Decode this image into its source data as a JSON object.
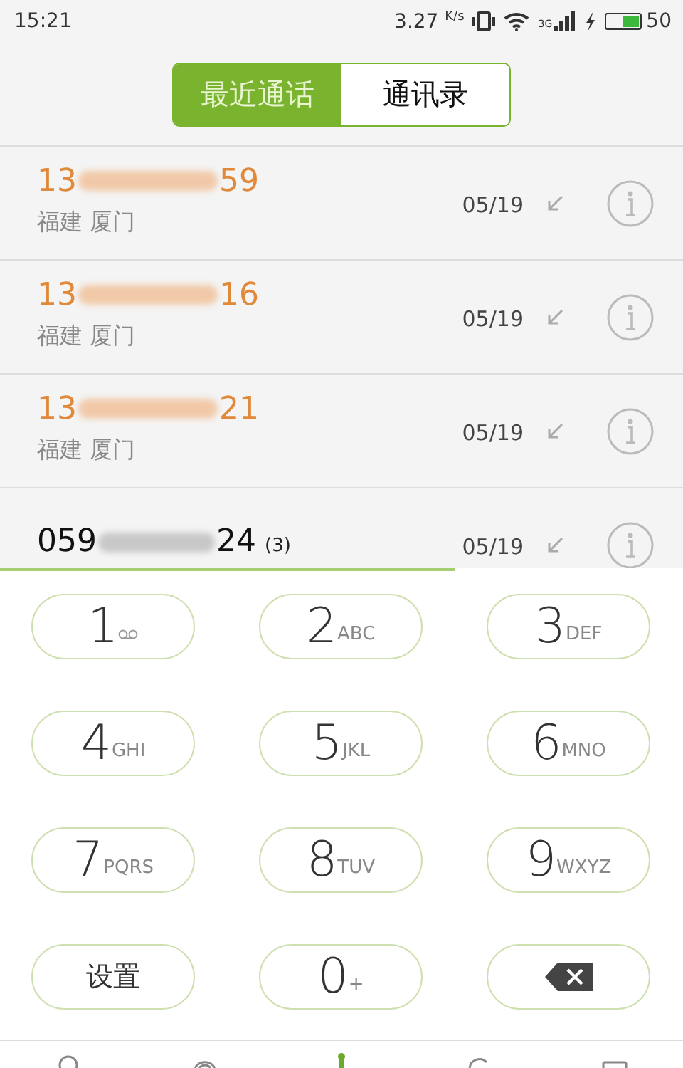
{
  "status_bar": {
    "time": "15:21",
    "speed": "3.27",
    "speed_unit": "K/s",
    "network": "3G",
    "battery": "50"
  },
  "tabs": [
    {
      "label": "最近通话",
      "selected": true
    },
    {
      "label": "通讯录",
      "selected": false
    }
  ],
  "calls": [
    {
      "number_start": "13",
      "number_end": "59",
      "location": "福建 厦门",
      "date": "05/19",
      "missed": true
    },
    {
      "number_start": "13",
      "number_end": "16",
      "location": "福建 厦门",
      "date": "05/19",
      "missed": true
    },
    {
      "number_start": "13",
      "number_end": "21",
      "location": "福建 厦门",
      "date": "05/19",
      "missed": true
    },
    {
      "number_start": "059",
      "number_end": "24",
      "count": "(3)",
      "date": "05/19",
      "missed": false
    }
  ],
  "keypad": [
    {
      "kind": "digit",
      "digit": "1",
      "voicemail": true
    },
    {
      "kind": "digit",
      "digit": "2",
      "letters": "ABC"
    },
    {
      "kind": "digit",
      "digit": "3",
      "letters": "DEF"
    },
    {
      "kind": "digit",
      "digit": "4",
      "letters": "GHI"
    },
    {
      "kind": "digit",
      "digit": "5",
      "letters": "JKL"
    },
    {
      "kind": "digit",
      "digit": "6",
      "letters": "MNO"
    },
    {
      "kind": "digit",
      "digit": "7",
      "letters": "PQRS"
    },
    {
      "kind": "digit",
      "digit": "8",
      "letters": "TUV"
    },
    {
      "kind": "digit",
      "digit": "9",
      "letters": "WXYZ"
    },
    {
      "kind": "text",
      "label": "设置"
    },
    {
      "kind": "digit",
      "digit": "0",
      "letters": "+"
    },
    {
      "kind": "delete"
    }
  ]
}
